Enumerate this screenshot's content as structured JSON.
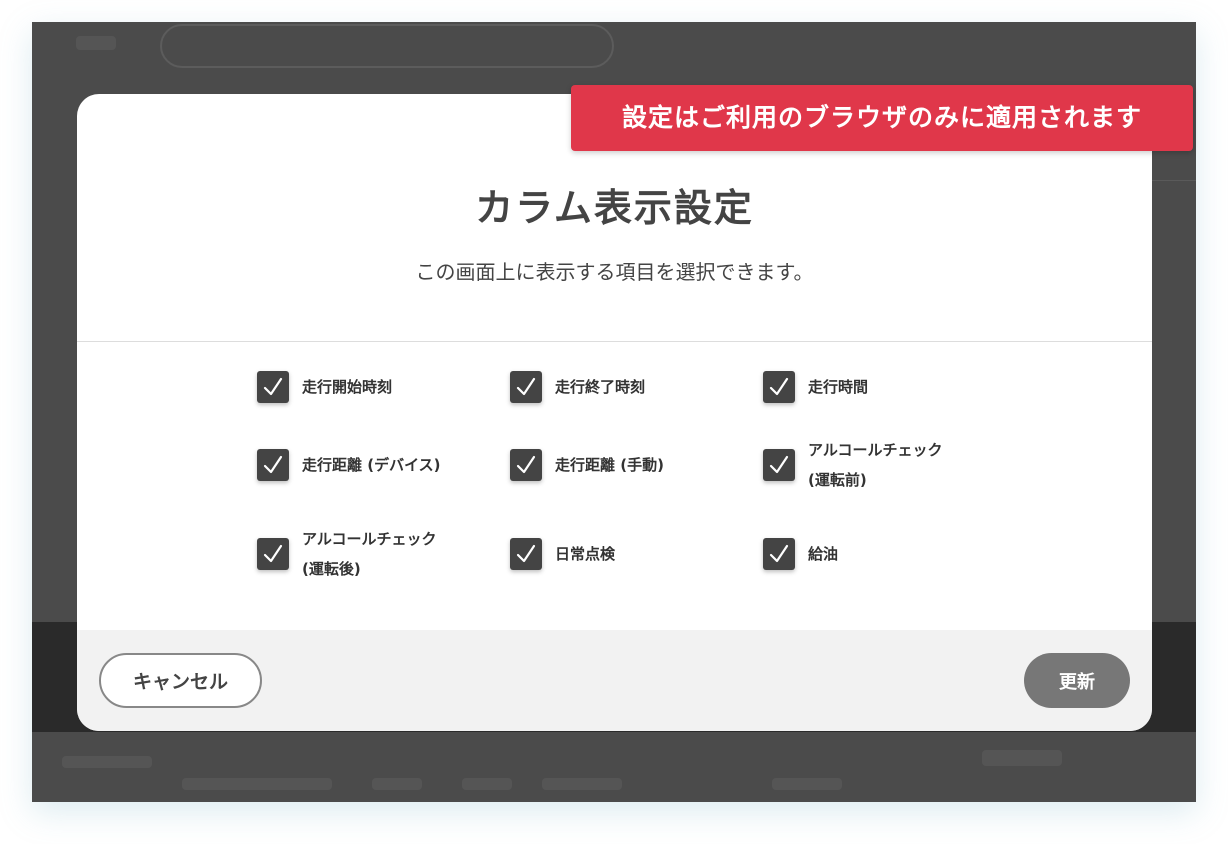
{
  "notice": {
    "text": "設定はご利用のブラウザのみに適用されます"
  },
  "modal": {
    "title": "カラム表示設定",
    "subtitle": "この画面上に表示する項目を選択できます。",
    "options": [
      {
        "label": "走行開始時刻",
        "checked": true
      },
      {
        "label": "走行終了時刻",
        "checked": true
      },
      {
        "label": "走行時間",
        "checked": true
      },
      {
        "label": "走行距離 (デバイス)",
        "checked": true
      },
      {
        "label": "走行距離 (手動)",
        "checked": true
      },
      {
        "label": "アルコールチェック\n(運転前)",
        "checked": true
      },
      {
        "label": "アルコールチェック\n(運転後)",
        "checked": true
      },
      {
        "label": "日常点検",
        "checked": true
      },
      {
        "label": "給油",
        "checked": true
      }
    ],
    "cancel_label": "キャンセル",
    "update_label": "更新"
  },
  "icons": {
    "checkbox": "checkmark-icon"
  },
  "colors": {
    "notice_bg": "#e0374a",
    "checkbox_bg": "#444444",
    "update_button_bg": "#777777",
    "overlay_bg": "#4b4b4b"
  }
}
